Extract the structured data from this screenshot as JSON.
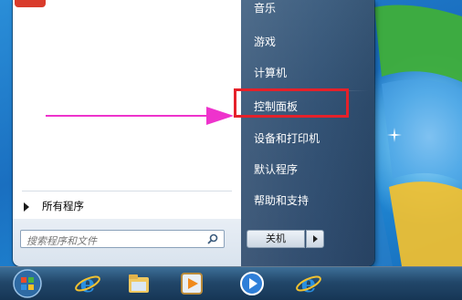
{
  "start_menu": {
    "right_items": [
      {
        "label": "音乐"
      },
      {
        "label": "游戏"
      },
      {
        "label": "计算机"
      },
      {
        "label": "控制面板"
      },
      {
        "label": "设备和打印机"
      },
      {
        "label": "默认程序"
      },
      {
        "label": "帮助和支持"
      }
    ],
    "all_programs_label": "所有程序",
    "search_placeholder": "搜索程序和文件",
    "shutdown_label": "关机"
  },
  "annotation": {
    "highlight_color": "#e5212a",
    "arrow_color": "#ee33cc"
  },
  "taskbar": {
    "items": [
      {
        "icon": "windows-start-orb"
      },
      {
        "icon": "internet-explorer-icon"
      },
      {
        "icon": "file-explorer-icon"
      },
      {
        "icon": "media-center-icon"
      },
      {
        "icon": "media-player-icon"
      },
      {
        "icon": "internet-explorer-icon"
      }
    ]
  }
}
